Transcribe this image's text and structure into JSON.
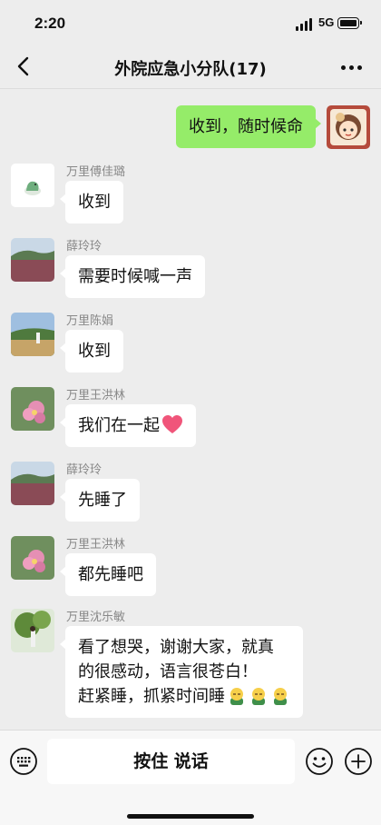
{
  "status_bar": {
    "time": "2:20",
    "network": "5G"
  },
  "header": {
    "title": "外院应急小分队(17)"
  },
  "messages": [
    {
      "sender": "",
      "text": "收到，随时候命",
      "avatar": "self-avatar"
    },
    {
      "sender": "万里傅佳璐",
      "text": "收到",
      "avatar": "dinosaur-avatar"
    },
    {
      "sender": "薛玲玲",
      "text": "需要时候喊一声",
      "avatar": "field-avatar"
    },
    {
      "sender": "万里陈娟",
      "text": "收到",
      "avatar": "meadow-avatar"
    },
    {
      "sender": "万里王洪林",
      "text": "我们在一起",
      "emoji": "heart",
      "avatar": "flower-avatar"
    },
    {
      "sender": "薛玲玲",
      "text": "先睡了",
      "avatar": "field-avatar"
    },
    {
      "sender": "万里王洪林",
      "text": "都先睡吧",
      "avatar": "flower-avatar"
    },
    {
      "sender": "万里沈乐敏",
      "line1": "看了想哭，谢谢大家，就真",
      "line2": "的很感动，语言很苍白！",
      "line3": "赶紧睡，抓紧时间睡",
      "emoji": "sleepy-face x3",
      "avatar": "tree-avatar"
    }
  ],
  "input_bar": {
    "hold_to_talk": "按住 说话"
  },
  "colors": {
    "background": "#ededed",
    "self_bubble": "#95ec69",
    "other_bubble": "#ffffff"
  }
}
